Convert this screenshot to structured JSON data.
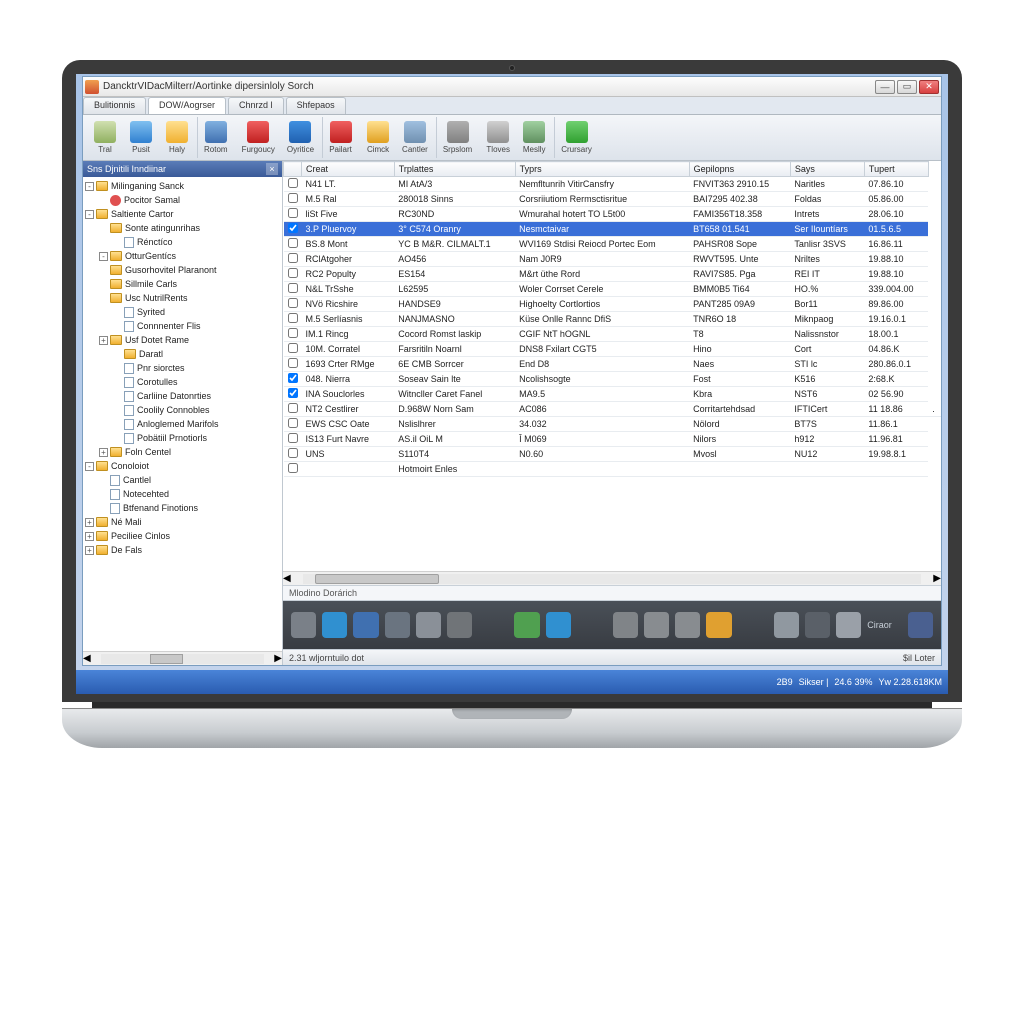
{
  "window": {
    "title": "DancktrVIDacMilterr/Aortinke dipersinloly Sorch"
  },
  "tabs": [
    {
      "label": "Bulitionnis",
      "active": false
    },
    {
      "label": "DOW/Aogrser",
      "active": true
    },
    {
      "label": "Chnrzd l",
      "active": false
    },
    {
      "label": "Shfepaos",
      "active": false
    }
  ],
  "toolbar": [
    {
      "name": "tool-tral",
      "label": "Tral",
      "color": "linear-gradient(#d0e0b0,#90b060)"
    },
    {
      "name": "tool-pust",
      "label": "Pusit",
      "color": "linear-gradient(#80c0f0,#3080d0)"
    },
    {
      "name": "tool-haly",
      "label": "Haly",
      "color": "linear-gradient(#ffe090,#f0b030)"
    },
    {
      "name": "tool-rotom",
      "label": "Rotom",
      "color": "linear-gradient(#80b0e0,#4070b0)",
      "sep": true
    },
    {
      "name": "tool-furgoucy",
      "label": "Furgoucy",
      "color": "linear-gradient(#f06060,#c02020)"
    },
    {
      "name": "tool-oyritice",
      "label": "Oyritice",
      "color": "linear-gradient(#4090e0,#2060b0)"
    },
    {
      "name": "tool-pailart",
      "label": "Pailart",
      "color": "linear-gradient(#f06060,#c02020)",
      "sep": true
    },
    {
      "name": "tool-cimck",
      "label": "Cimck",
      "color": "linear-gradient(#ffe090,#e0a020)"
    },
    {
      "name": "tool-cantler",
      "label": "Cantler",
      "color": "linear-gradient(#a0c0e0,#7090b0)"
    },
    {
      "name": "tool-srpslom",
      "label": "Srpslom",
      "color": "linear-gradient(#b0b0b0,#808080)",
      "sep": true
    },
    {
      "name": "tool-tloves",
      "label": "Tloves",
      "color": "linear-gradient(#d0d0d0,#909090)"
    },
    {
      "name": "tool-meslly",
      "label": "Meslly",
      "color": "linear-gradient(#a0d0a0,#609060)"
    },
    {
      "name": "tool-crursary",
      "label": "Crursary",
      "color": "linear-gradient(#70d070,#30a030)",
      "sep": true
    }
  ],
  "sidebar": {
    "title": "Sns Djnitili Inndiinar",
    "nodes": [
      {
        "d": 0,
        "exp": "-",
        "ico": "folder",
        "label": "Milinganing Sanck"
      },
      {
        "d": 1,
        "exp": "",
        "ico": "special",
        "label": "Pocitor Samal"
      },
      {
        "d": 0,
        "exp": "-",
        "ico": "folder",
        "label": "Saltiente Cartor"
      },
      {
        "d": 1,
        "exp": "",
        "ico": "folder",
        "label": "Sonte atingunrihas"
      },
      {
        "d": 2,
        "exp": "",
        "ico": "doc",
        "label": "Rénctíco"
      },
      {
        "d": 1,
        "exp": "-",
        "ico": "folder",
        "label": "OtturGentícs"
      },
      {
        "d": 1,
        "exp": "",
        "ico": "folder",
        "label": "Gusorhovitel Plaranont"
      },
      {
        "d": 1,
        "exp": "",
        "ico": "folder",
        "label": "Sillmile Carls"
      },
      {
        "d": 1,
        "exp": "",
        "ico": "folder",
        "label": "Usc NutrilRents"
      },
      {
        "d": 2,
        "exp": "",
        "ico": "doc",
        "label": "Syrited"
      },
      {
        "d": 2,
        "exp": "",
        "ico": "doc",
        "label": "Connnenter Flis"
      },
      {
        "d": 1,
        "exp": "+",
        "ico": "folder",
        "label": "Usf Dotet Rame"
      },
      {
        "d": 2,
        "exp": "",
        "ico": "folder",
        "label": "Daratl"
      },
      {
        "d": 2,
        "exp": "",
        "ico": "doc",
        "label": "Pnr siorctes"
      },
      {
        "d": 2,
        "exp": "",
        "ico": "doc",
        "label": "Corotulles"
      },
      {
        "d": 2,
        "exp": "",
        "ico": "doc",
        "label": "Carliine Datonrties"
      },
      {
        "d": 2,
        "exp": "",
        "ico": "doc",
        "label": "Coolily Connobles"
      },
      {
        "d": 2,
        "exp": "",
        "ico": "doc",
        "label": "Anloglemed Marifols"
      },
      {
        "d": 2,
        "exp": "",
        "ico": "doc",
        "label": "Pobätiil Prnotiorls"
      },
      {
        "d": 1,
        "exp": "+",
        "ico": "folder",
        "label": "Foln Centel"
      },
      {
        "d": 0,
        "exp": "-",
        "ico": "folder",
        "label": "Conoloiot"
      },
      {
        "d": 1,
        "exp": "",
        "ico": "doc",
        "label": "Cantlel"
      },
      {
        "d": 1,
        "exp": "",
        "ico": "doc",
        "label": "Notecehted"
      },
      {
        "d": 1,
        "exp": "",
        "ico": "doc",
        "label": "Btfenand Finotions"
      },
      {
        "d": 0,
        "exp": "+",
        "ico": "folder",
        "label": "Né Mali"
      },
      {
        "d": 0,
        "exp": "+",
        "ico": "folder",
        "label": "Peciliee Cinlos"
      },
      {
        "d": 0,
        "exp": "+",
        "ico": "folder",
        "label": "De Fals"
      }
    ]
  },
  "table": {
    "headers": [
      "",
      "Creat",
      "Trplattes",
      "Typrs",
      "Gepilopns",
      "Says",
      "Tupert"
    ],
    "rows": [
      {
        "c": false,
        "sel": false,
        "v": [
          "N41 LT.",
          "MI AtA/3",
          "Nemfltunrih VitirCansfry",
          "FNVIT363 2910.15",
          "Naritles",
          "07.86.10"
        ]
      },
      {
        "c": false,
        "sel": false,
        "v": [
          "M.5 Ral",
          "280018 Sinns",
          "Corsriiutiom Rermsctisritue",
          "BAI7295 402.38",
          "Foldas",
          "05.86.00"
        ]
      },
      {
        "c": false,
        "sel": false,
        "v": [
          "liSt Five",
          "RC30ND",
          "Wmurahal hotert TO L5t00",
          "FAMI356T18.358",
          "Intrets",
          "28.06.10"
        ]
      },
      {
        "c": true,
        "sel": true,
        "v": [
          "3.P Pluervoy",
          "3° C574 Oranry",
          "Nesmctaivar",
          "BT658 01.541",
          "Ser Ilountíars",
          "01.5.6.5"
        ]
      },
      {
        "c": false,
        "sel": false,
        "v": [
          "BS.8 Mont",
          "YC B M&R. CILMALT.1",
          "WVI169 Stdisi Reiocd Portec Eom",
          "PAHSR08 Sope",
          "Tanlisr 3SVS",
          "16.86.11"
        ]
      },
      {
        "c": false,
        "sel": false,
        "v": [
          "RClAtgoher",
          "AO456",
          "Nam J0R9",
          "RWVT595. Unte",
          "Nriltes",
          "19.88.10"
        ]
      },
      {
        "c": false,
        "sel": false,
        "v": [
          "RC2 Populty",
          "ES154",
          "M&rt üthe Rord",
          "RAVI7S85. Pga",
          "REI IT",
          "19.88.10"
        ]
      },
      {
        "c": false,
        "sel": false,
        "v": [
          "N&L TrSshe",
          "L62595",
          "Woler Corrset Cerele",
          "BMM0B5 Ti64",
          "HO.%",
          "339.004.00"
        ]
      },
      {
        "c": false,
        "sel": false,
        "v": [
          "NVö Ricshire",
          "HANDSE9",
          "Highoelty Cortlortios",
          "PANT285 09A9",
          "Bor11",
          "89.86.00"
        ]
      },
      {
        "c": false,
        "sel": false,
        "v": [
          "M.5 Serlíasnis",
          "NANJMASNO",
          "Küse Onlle Rannc DfiS",
          "TNR6O 18",
          "Miknpaog",
          "19.16.0.1"
        ]
      },
      {
        "c": false,
        "sel": false,
        "v": [
          "IM.1 Rincg",
          "Cocord Romst laskip",
          "CGIF NtT hOGNL",
          "T8",
          "Nalissnstor",
          "18.00.1"
        ]
      },
      {
        "c": false,
        "sel": false,
        "v": [
          "10M. Corratel",
          "Farsritiln Noarnl",
          "DNS8 Fxilart CGT5",
          "Hino",
          "Cort",
          "04.86.K"
        ]
      },
      {
        "c": false,
        "sel": false,
        "v": [
          "1693 Crter RMge",
          "6E CMB Sorrcer",
          "End D8",
          "Naes",
          "STI lc",
          "280.86.0.1"
        ]
      },
      {
        "c": true,
        "sel": false,
        "v": [
          "048. Nierra",
          "Soseav Sain lte",
          "Ncolishsogte",
          "Fost",
          "K516",
          "2:68.K"
        ]
      },
      {
        "c": true,
        "sel": false,
        "v": [
          "INA Souclorles",
          "Witncller Caret Fanel",
          "MA9.5",
          "Kbra",
          "NST6",
          "02 56.90"
        ]
      },
      {
        "c": false,
        "sel": false,
        "v": [
          "NT2 Cestlirer",
          "D.968W Norn Sam",
          "AC086",
          "Corritartehdsad",
          "IFTICert",
          "11 18.86",
          "."
        ]
      },
      {
        "c": false,
        "sel": false,
        "v": [
          "EWS CSC Oate",
          "Nslislhrer",
          "34.032",
          "Nölord",
          "BT7S",
          "11.86.1"
        ]
      },
      {
        "c": false,
        "sel": false,
        "v": [
          "IS13 Furt Navre",
          "AS.il OiL M",
          "Î M069",
          "Nilors",
          "h912",
          "11.96.81"
        ]
      },
      {
        "c": false,
        "sel": false,
        "v": [
          "UNS",
          "S110T4",
          "N0.60",
          "Mvosl",
          "NU12",
          "19.98.8.1"
        ]
      },
      {
        "c": false,
        "sel": false,
        "v": [
          "",
          "Hotmoirt Enles",
          "",
          "",
          "",
          ""
        ]
      }
    ]
  },
  "detail_header": "Mlodino Dorárich",
  "dock_label": "Ciraor",
  "status": {
    "left": "2.31 wljorntuilo dot",
    "right": "$il Loter"
  },
  "taskbar": {
    "items": [
      "2B9",
      "Sikser |",
      "24.6 39%",
      "Yw 2.28.618KM"
    ]
  }
}
